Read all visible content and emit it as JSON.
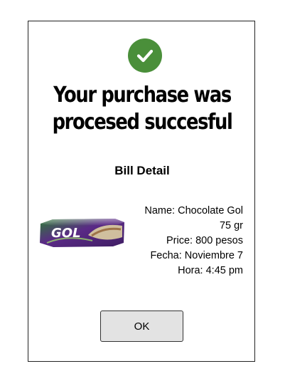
{
  "dialog": {
    "headline_line1": "Your purchase was",
    "headline_line2": "procesed succesful",
    "subtitle": "Bill Detail"
  },
  "product": {
    "image_alt_icon": "chocolate-bar-image",
    "image_text": "GOL",
    "name_line": "Name: Chocolate Gol",
    "weight_line": "75 gr",
    "price_line": "Price: 800 pesos",
    "date_line": "Fecha: Noviembre 7",
    "time_line": "Hora: 4:45 pm"
  },
  "actions": {
    "ok_label": "OK"
  },
  "colors": {
    "success": "#4a8f3a"
  },
  "icons": {
    "status": "checkmark-circle-icon"
  }
}
